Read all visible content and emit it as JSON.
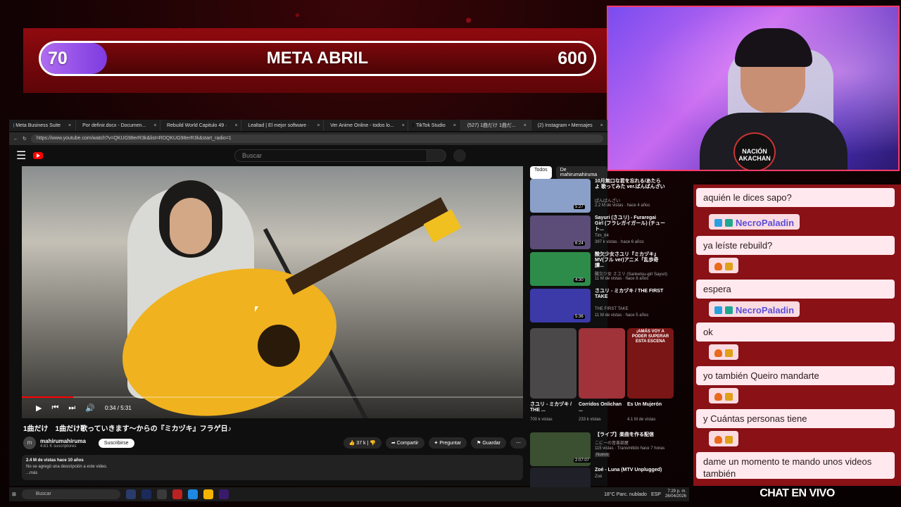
{
  "goal": {
    "current": "70",
    "title": "META ABRIL",
    "target": "600",
    "progress_fraction": 0.117
  },
  "webcam": {
    "logo_text": "NACIÓN AKACHAN"
  },
  "chat": {
    "messages": [
      {
        "user": "",
        "text": "aquién le dices sapo?"
      },
      {
        "user": "NecroPaladin",
        "text": "ya leíste rebuild?"
      },
      {
        "user": "",
        "text": "espera"
      },
      {
        "user": "NecroPaladin",
        "text": "ok"
      },
      {
        "user": "",
        "text": "yo también Queiro mandarte"
      },
      {
        "user": "",
        "text": "y Cuántas personas tiene"
      },
      {
        "user": "",
        "text": "dame un momento te mando unos videos también"
      }
    ],
    "footer": "CHAT EN VIVO"
  },
  "browser": {
    "tabs": [
      {
        "label": "Meta Business Suite",
        "color": "#1877f2"
      },
      {
        "label": "Por definir.docx - Documen...",
        "color": "#2b579a"
      },
      {
        "label": "Rebuild World Capitulo 49 ·",
        "color": "#2aa890"
      },
      {
        "label": "Lealtad | El mejor software ·",
        "color": "#e0e0e0"
      },
      {
        "label": "Ver Anime Online - todos lo...",
        "color": "#3a8ee6"
      },
      {
        "label": "TikTok Studio",
        "color": "#111"
      },
      {
        "label": "(527) 1曲だけ 1曲だ...",
        "color": "#f00"
      },
      {
        "label": "(2) Instagram • Mensajes",
        "color": "#d62976"
      }
    ],
    "url": "https://www.youtube.com/watch?v=QKUG98erR3k&list=RDQKUG98erR3k&start_radio=1"
  },
  "youtube": {
    "search_placeholder": "Buscar",
    "video": {
      "time": "0:34 / 5:31",
      "progress_fraction": 0.103,
      "title": "1曲だけ　1曲だけ歌っていきます〜からの『ミカヅキ』フラゲ日♪",
      "channel": "mahirumahiruma",
      "subscribers": "4.61 K suscriptores",
      "subscribe_label": "Suscribirse",
      "likes": "37 k",
      "share_label": "Compartir",
      "ask_label": "Preguntar",
      "save_label": "Guardar",
      "views": "2.4 M de vistas  hace 10 años",
      "description": "No se agregó una descripción a este video.",
      "more": "...más"
    },
    "chips": [
      "Todos",
      "De mahirumahiruma"
    ],
    "recommended": [
      {
        "title": "10月無口な君を忘れる/あたらよ 歌ってみた ver.ぱんばんざい",
        "channel": "ぱんばんざい",
        "meta": "2.2 M de vistas · hace 4 años",
        "duration": "5:27",
        "color": "#8aa0c8"
      },
      {
        "title": "Sayuri (さユリ) - Furaregai Girl (フラレガイガール) (チュート...",
        "channel": "Tim_64",
        "meta": "397 k vistas · hace 6 años",
        "duration": "6:24",
        "color": "#5b4c78"
      },
      {
        "title": "酸欠少女さユリ『ミカヅキ』MV(フル ver)アニメ「乱歩奇譚...",
        "channel": "酸欠少女 さユリ (Sanketsu-girl Sayuri)",
        "meta": "11 M de vistas · hace 8 años",
        "duration": "4:30",
        "color": "#2d8c4a"
      },
      {
        "title": "さユリ - ミカヅキ / THE FIRST TAKE",
        "channel": "THE FIRST TAKE",
        "meta": "11 M de vistas · hace 5 años",
        "duration": "5:36",
        "color": "#3b3aa8"
      }
    ],
    "shorts": [
      {
        "title": "さユリ - ミカヅキ / THE ...",
        "views": "700 k vistas",
        "overlay": "",
        "color": "#4a4848"
      },
      {
        "title": "Corridos Onlichan ...",
        "views": "233 k vistas",
        "overlay": "",
        "color": "#a0323a"
      },
      {
        "title": "Es Un Mujerón",
        "views": "4.1 M de vistas",
        "overlay": "¡AMÁS VOY A PODER SUPERAR ESTA ESCENA",
        "color": "#7a1616"
      }
    ],
    "recommended_lower": [
      {
        "title": "【ライブ】楽曲を作る配信",
        "channel": "こにーの音楽部屋",
        "meta": "115 vistas · Transmitido hace 7 horas",
        "badge": "Nuevo",
        "duration": "2:07:07",
        "color": "#3a5030"
      },
      {
        "title": "Zoé - Luna (MTV Unplugged)",
        "channel": "Zoé",
        "meta": "",
        "badge": "",
        "duration": "",
        "color": "#202028"
      }
    ]
  },
  "taskbar": {
    "search_placeholder": "Buscar",
    "weather": "18°C  Parc. nublado",
    "lang": "ESP",
    "time": "7:29 p. m.",
    "date": "26/04/2026"
  },
  "colors": {
    "accent_purple": "#9a52ea",
    "chat_bg": "#8a1116",
    "youtube_red": "#ff0000"
  }
}
